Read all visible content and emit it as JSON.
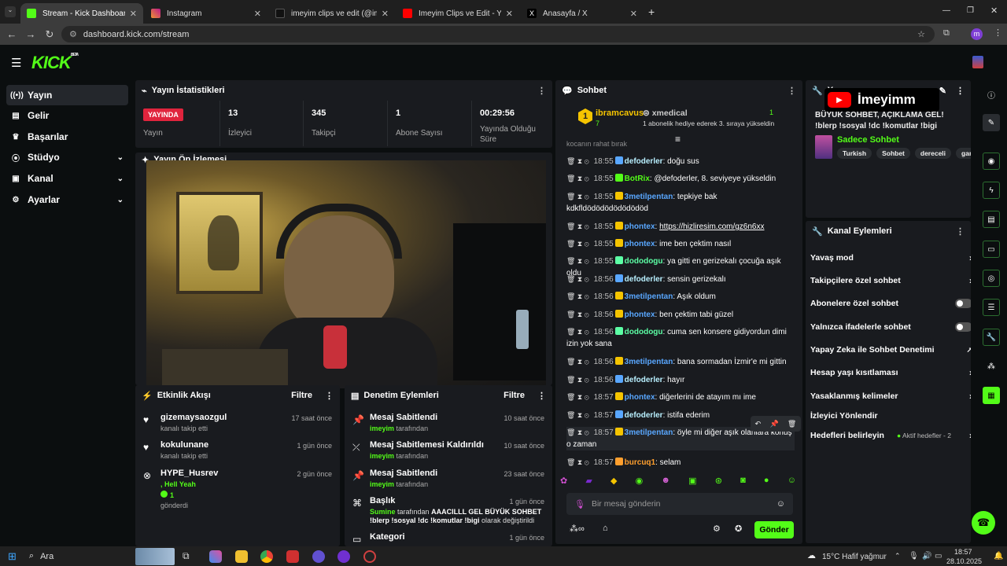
{
  "browser": {
    "tabs": [
      {
        "title": "Stream - Kick Dashboard",
        "active": true
      },
      {
        "title": "Instagram"
      },
      {
        "title": "imeyim clips ve edit (@imeyimi..."
      },
      {
        "title": "İmeyim Clips ve Edit - YouTube"
      },
      {
        "title": "Anasayfa / X"
      }
    ],
    "new_tab": "+",
    "url": "dashboard.kick.com/stream",
    "profile_initial": "m"
  },
  "header": {
    "logo": "KICK",
    "logo_tag": "BETA"
  },
  "sidebar": {
    "items": [
      {
        "label": "Yayın",
        "icon": "broadcast-icon",
        "selected": true
      },
      {
        "label": "Gelir",
        "icon": "revenue-icon"
      },
      {
        "label": "Başarılar",
        "icon": "trophy-icon"
      },
      {
        "label": "Stüdyo",
        "icon": "studio-icon",
        "expandable": true
      },
      {
        "label": "Kanal",
        "icon": "channel-icon",
        "expandable": true
      },
      {
        "label": "Ayarlar",
        "icon": "gear-icon",
        "expandable": true
      }
    ]
  },
  "stats": {
    "title": "Yayın İstatistikleri",
    "live_badge": "YAYINDA",
    "live_label": "Yayın",
    "items": [
      {
        "value": "13",
        "label": "İzleyici"
      },
      {
        "value": "345",
        "label": "Takipçi"
      },
      {
        "value": "1",
        "label": "Abone Sayısı"
      },
      {
        "value": "00:29:56",
        "label": "Yayında Olduğu Süre"
      }
    ]
  },
  "preview": {
    "title": "Yayın Ön İzlemesi"
  },
  "activity": {
    "title": "Etkinlik Akışı",
    "filter": "Filtre",
    "items": [
      {
        "name": "gizemaysaozgul",
        "sub": "kanalı takip etti",
        "time": "17 saat önce"
      },
      {
        "name": "kokulunane",
        "sub": "kanalı takip etti",
        "time": "1 gün önce"
      },
      {
        "name": "HYPE_Husrev",
        "sub": ", Hell Yeah",
        "count": "1",
        "sub2": "gönderdi",
        "time": "2 gün önce"
      }
    ]
  },
  "moderation": {
    "title": "Denetim Eylemleri",
    "filter": "Filtre",
    "items": [
      {
        "name": "Mesaj Sabitlendi",
        "by": "imeyim",
        "by_suffix": "tarafından",
        "time": "10 saat önce"
      },
      {
        "name": "Mesaj Sabitlemesi Kaldırıldı",
        "by": "imeyim",
        "by_suffix": "tarafından",
        "time": "10 saat önce"
      },
      {
        "name": "Mesaj Sabitlendi",
        "by": "imeyim",
        "by_suffix": "tarafından",
        "time": "23 saat önce"
      },
      {
        "name": "Başlık",
        "by": "Sumine",
        "by_suffix": "tarafından",
        "detail": "AAACILLL GEL BÜYÜK SOHBET !blerp !sosyal !dc !komutlar !bigi",
        "detail_suffix": "olarak değiştirildi",
        "time": "1 gün önce"
      },
      {
        "name": "Kategori",
        "time": "1 gün önce"
      }
    ]
  },
  "chat": {
    "title": "Sohbet",
    "top_gifter": {
      "rank": "1",
      "name": "ibramcavus",
      "count": "7"
    },
    "gift_user": {
      "name": "xmedical",
      "count": "1",
      "text": "1 abonelik hediye ederek 3. sıraya yükseldin"
    },
    "cut_line": "kocanın rahat bırak",
    "messages": [
      {
        "time": "18:55",
        "user": "defoderler",
        "cls": "u3",
        "text": ": doğu sus"
      },
      {
        "time": "18:55",
        "user": "BotRix",
        "cls": "u1",
        "text": ": @defoderler, 8. seviyeye yükseldin"
      },
      {
        "time": "18:55",
        "user": "3metilpentan",
        "cls": "u2",
        "text": ": tepkiye bak kdkfldödödödödödödöd"
      },
      {
        "time": "18:55",
        "user": "phontex",
        "cls": "u2",
        "text": ": ",
        "link": "https://hizliresim.com/gz6n6xx"
      },
      {
        "time": "18:55",
        "user": "phontex",
        "cls": "u2",
        "text": ": ime ben çektim nasıl"
      },
      {
        "time": "18:55",
        "user": "dododogu",
        "cls": "u6",
        "text": ": ya gitti en gerizekalı çocuğa aşık oldu"
      },
      {
        "time": "18:56",
        "user": "defoderler",
        "cls": "u3",
        "text": ": sensin gerizekalı"
      },
      {
        "time": "18:56",
        "user": "3metilpentan",
        "cls": "u2",
        "text": ": Aşık oldum"
      },
      {
        "time": "18:56",
        "user": "phontex",
        "cls": "u2",
        "text": ": ben çektim tabi güzel"
      },
      {
        "time": "18:56",
        "user": "dododogu",
        "cls": "u6",
        "text": ": cuma sen konsere gidiyordun dimi izin yok sana"
      },
      {
        "time": "18:56",
        "user": "3metilpentan",
        "cls": "u2",
        "text": ": bana sormadan İzmir'e mi gittin"
      },
      {
        "time": "18:56",
        "user": "defoderler",
        "cls": "u3",
        "text": ": hayır"
      },
      {
        "time": "18:57",
        "user": "phontex",
        "cls": "u2",
        "text": ": diğerlerini de atayım mı ime"
      },
      {
        "time": "18:57",
        "user": "defoderler",
        "cls": "u3",
        "text": ": istifa ederim"
      },
      {
        "time": "18:57",
        "user": "3metilpentan",
        "cls": "u2",
        "text": ": öyle mi diğer aşık olanlara konuş o zaman"
      },
      {
        "time": "18:57",
        "user": "burcuq1",
        "cls": "u4",
        "text": ": selam"
      }
    ],
    "input_placeholder": "Bir mesaj gönderin",
    "send": "Gönder"
  },
  "yt_overlay": "İmeyimm",
  "stream_info": {
    "title_prefix": "Y",
    "text": "BÜYÜK SOHBET, AÇIKLAMA GEL! !blerp !sosyal !dc !komutlar !bigi",
    "category": "Sadece Sohbet",
    "tags": [
      "Turkish",
      "Sohbet",
      "dereceli",
      "gamin"
    ]
  },
  "channel_actions": {
    "title": "Kanal Eylemleri",
    "items": [
      {
        "label": "Yavaş mod",
        "type": "arrow"
      },
      {
        "label": "Takipçilere özel sohbet",
        "type": "arrow"
      },
      {
        "label": "Abonelere özel sohbet",
        "type": "toggle"
      },
      {
        "label": "Yalnızca ifadelerle sohbet",
        "type": "toggle"
      },
      {
        "label": "Yapay Zeka ile Sohbet Denetimi",
        "type": "external"
      },
      {
        "label": "Hesap yaşı kısıtlaması",
        "type": "arrow"
      },
      {
        "label": "Yasaklanmış kelimeler",
        "type": "arrow"
      },
      {
        "label": "İzleyici Yönlendir",
        "type": "none"
      },
      {
        "label": "Hedefleri belirleyin",
        "type": "arrow",
        "extra": "Aktif hedefler - 2"
      }
    ]
  },
  "taskbar": {
    "search": "Ara",
    "weather": "15°C  Hafif yağmur",
    "time": "18:57",
    "date": "28.10.2025"
  }
}
